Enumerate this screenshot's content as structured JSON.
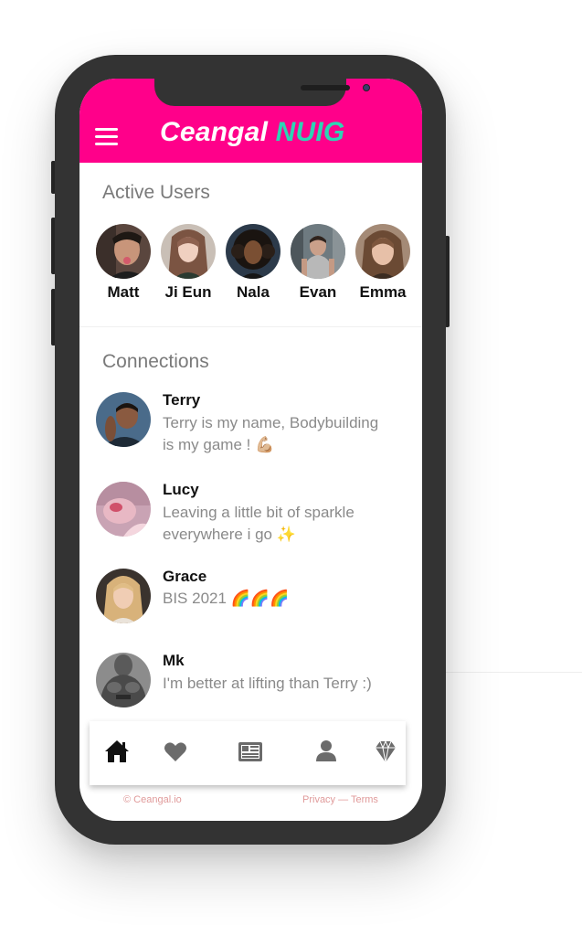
{
  "header": {
    "title_main": "Ceangal",
    "title_accent": "NUIG",
    "brand_color": "#ff008a",
    "accent_color": "#2dd4b4",
    "menu_icon": "hamburger-menu-icon"
  },
  "active_users": {
    "title": "Active Users",
    "users": [
      {
        "name": "Matt"
      },
      {
        "name": "Ji Eun"
      },
      {
        "name": "Nala"
      },
      {
        "name": "Evan"
      },
      {
        "name": "Emma"
      }
    ]
  },
  "connections": {
    "title": "Connections",
    "items": [
      {
        "name": "Terry",
        "status_line1": "Terry is my name, Bodybuilding",
        "status_line2": "is my game ! 💪🏼"
      },
      {
        "name": "Lucy",
        "status_line1": "Leaving a little bit of sparkle",
        "status_line2": "everywhere i go ✨"
      },
      {
        "name": "Grace",
        "status_line1": "BIS 2021 🌈🌈🌈",
        "status_line2": ""
      },
      {
        "name": "Mk",
        "status_line1": "I'm better at lifting than Terry :)",
        "status_line2": ""
      }
    ]
  },
  "bottom_nav": {
    "items": [
      "home-icon",
      "heart-icon",
      "newspaper-icon",
      "user-icon",
      "diamond-icon"
    ]
  },
  "footer": {
    "copyright": "© Ceangal.io",
    "privacy": "Privacy",
    "separator": " — ",
    "terms": "Terms"
  }
}
